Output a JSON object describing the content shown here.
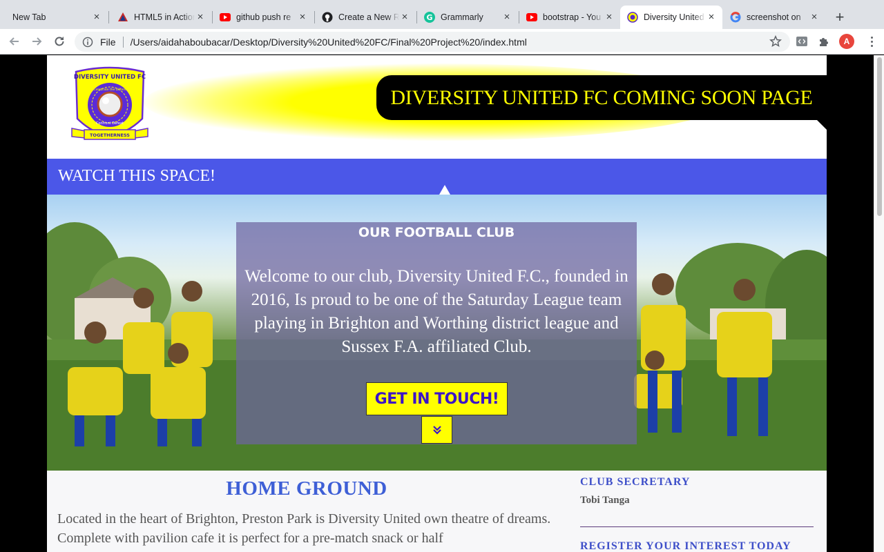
{
  "browser": {
    "tabs": [
      {
        "title": "New Tab",
        "icon": "none",
        "active": false
      },
      {
        "title": "HTML5 in Action",
        "icon": "html5-triangle-icon",
        "active": false
      },
      {
        "title": "github push re",
        "icon": "youtube-icon",
        "active": false
      },
      {
        "title": "Create a New R",
        "icon": "github-icon",
        "active": false
      },
      {
        "title": "Grammarly",
        "icon": "grammarly-icon",
        "active": false
      },
      {
        "title": "bootstrap - You",
        "icon": "youtube-icon",
        "active": false
      },
      {
        "title": "Diversity United",
        "icon": "club-crest-icon",
        "active": true
      },
      {
        "title": "screenshot on",
        "icon": "google-icon",
        "active": false
      }
    ],
    "close_glyph": "×",
    "new_tab_glyph": "+",
    "url_scheme": "File",
    "url": "/Users/aidahaboubacar/Desktop/Diversity%20United%20FC/Final%20Project%20/index.html",
    "profile_initial": "A",
    "colors": {
      "tabstrip": "#dee1e6",
      "youtube": "#ff0000",
      "grammarly": "#15c39a",
      "avatar": "#e8453c"
    }
  },
  "site": {
    "logo": {
      "top_text": "DIVERSITY UNITED FC",
      "ring_text": "We Celebrate the Difference",
      "motto": "Confront Defeat",
      "ribbon": "TOGETHERNESS"
    },
    "title": "DIVERSITY UNITED FC COMING SOON PAGE",
    "watch_banner": "WATCH THIS SPACE!",
    "hero": {
      "heading": "OUR FOOTBALL CLUB",
      "text": "Welcome to our club, Diversity United F.C., founded in 2016, Is proud to be one of the Saturday League team playing in Brighton and Worthing district league and Sussex F.A. affiliated Club.",
      "cta": "GET IN TOUCH!",
      "scroll_icon": "double-chevron-down-icon"
    },
    "home_ground": {
      "title": "HOME GROUND",
      "text": "Located in the heart of Brighton, Preston Park is Diversity United own theatre of dreams. Complete with pavilion cafe it is perfect for a pre-match snack or half"
    },
    "sidebar": {
      "secretary_heading": "CLUB SECRETARY",
      "secretary_name": "Tobi Tanga",
      "register_heading": "REGISTER YOUR INTEREST TODAY"
    },
    "colors": {
      "yellow": "#ffff00",
      "blue_bar": "#4b57e8",
      "heading_blue": "#3e5fd6",
      "cta_text": "#3c14c8"
    }
  }
}
